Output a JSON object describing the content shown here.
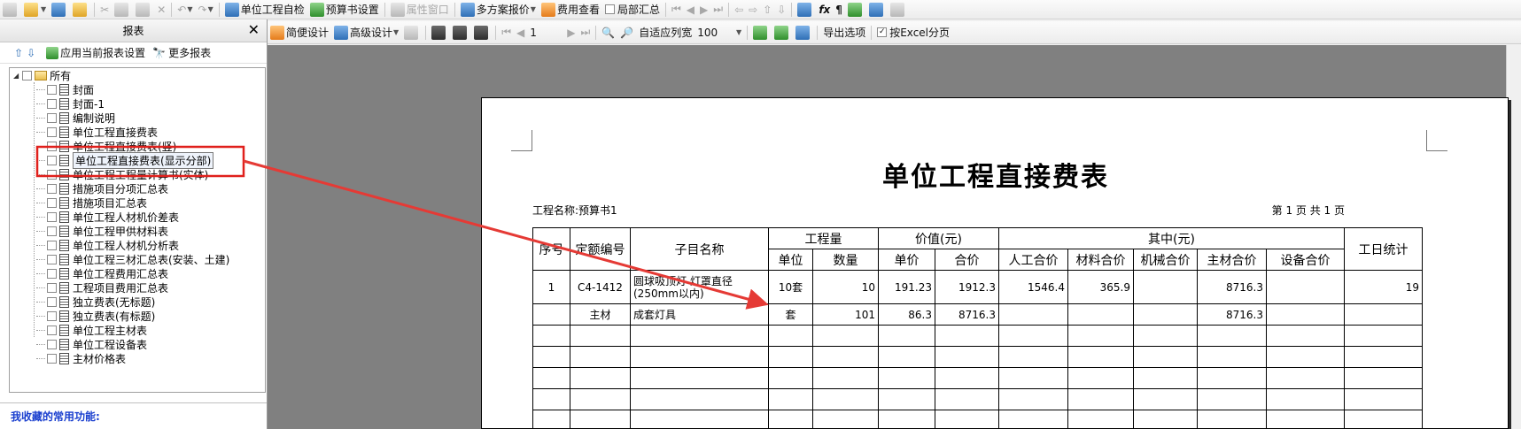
{
  "toolbar1": {
    "unit_check": "单位工程自检",
    "budget_settings": "预算书设置",
    "property_window": "属性窗口",
    "multi_scheme_quote": "多方案报价",
    "cost_view": "费用查看",
    "partial_summary": "局部汇总"
  },
  "toolbar2": {
    "simple_design": "简便设计",
    "advanced_design": "高级设计",
    "page_number": "1",
    "fit_width": "自适应列宽",
    "zoom": "100",
    "export_options": "导出选项",
    "excel_paging": "按Excel分页"
  },
  "panel": {
    "title": "报表",
    "close": "✕",
    "apply_settings": "应用当前报表设置",
    "more_reports": "更多报表",
    "favorites_label": "我收藏的常用功能:"
  },
  "tree": {
    "root": "所有",
    "items": [
      "封面",
      "封面-1",
      "编制说明",
      "单位工程直接费表",
      "单位工程直接费表(竖)",
      "单位工程直接费表(显示分部)",
      "单位工程工程量计算书(实体)",
      "措施项目分项汇总表",
      "措施项目汇总表",
      "单位工程人材机价差表",
      "单位工程甲供材料表",
      "单位工程人材机分析表",
      "单位工程三材汇总表(安装、土建)",
      "单位工程费用汇总表",
      "工程项目费用汇总表",
      "独立费表(无标题)",
      "独立费表(有标题)",
      "单位工程主材表",
      "单位工程设备表",
      "主材价格表"
    ]
  },
  "report": {
    "title": "单位工程直接费表",
    "project_name": "工程名称:预算书1",
    "page_info": "第 1 页    共 1 页",
    "headers": {
      "seq": "序号",
      "code": "定额编号",
      "name": "子目名称",
      "quantity_group": "工程量",
      "value_group": "价值(元)",
      "of_which": "其中(元)",
      "workday": "工日统计",
      "unit": "单位",
      "qty": "数量",
      "unit_price": "单价",
      "total_price": "合价",
      "labor": "人工合价",
      "material": "材料合价",
      "machine": "机械合价",
      "main_material": "主材合价",
      "equipment": "设备合价"
    },
    "rows": [
      {
        "seq": "1",
        "code": "C4-1412",
        "name": "圆球吸顶灯 灯罩直径(250mm以内)",
        "unit": "10套",
        "qty": "10",
        "unit_price": "191.23",
        "total_price": "1912.3",
        "labor": "1546.4",
        "material": "365.9",
        "machine": "",
        "main_material": "8716.3",
        "equipment": "",
        "workday": "19"
      },
      {
        "seq": "",
        "code": "主材",
        "name": "成套灯具",
        "unit": "套",
        "qty": "101",
        "unit_price": "86.3",
        "total_price": "8716.3",
        "labor": "",
        "material": "",
        "machine": "",
        "main_material": "8716.3",
        "equipment": "",
        "workday": ""
      }
    ]
  },
  "colors": {
    "highlight_box": "#e0201c",
    "arrow": "#e53a35",
    "favorites_text": "#1a3fcf",
    "preview_bg": "#808080"
  }
}
